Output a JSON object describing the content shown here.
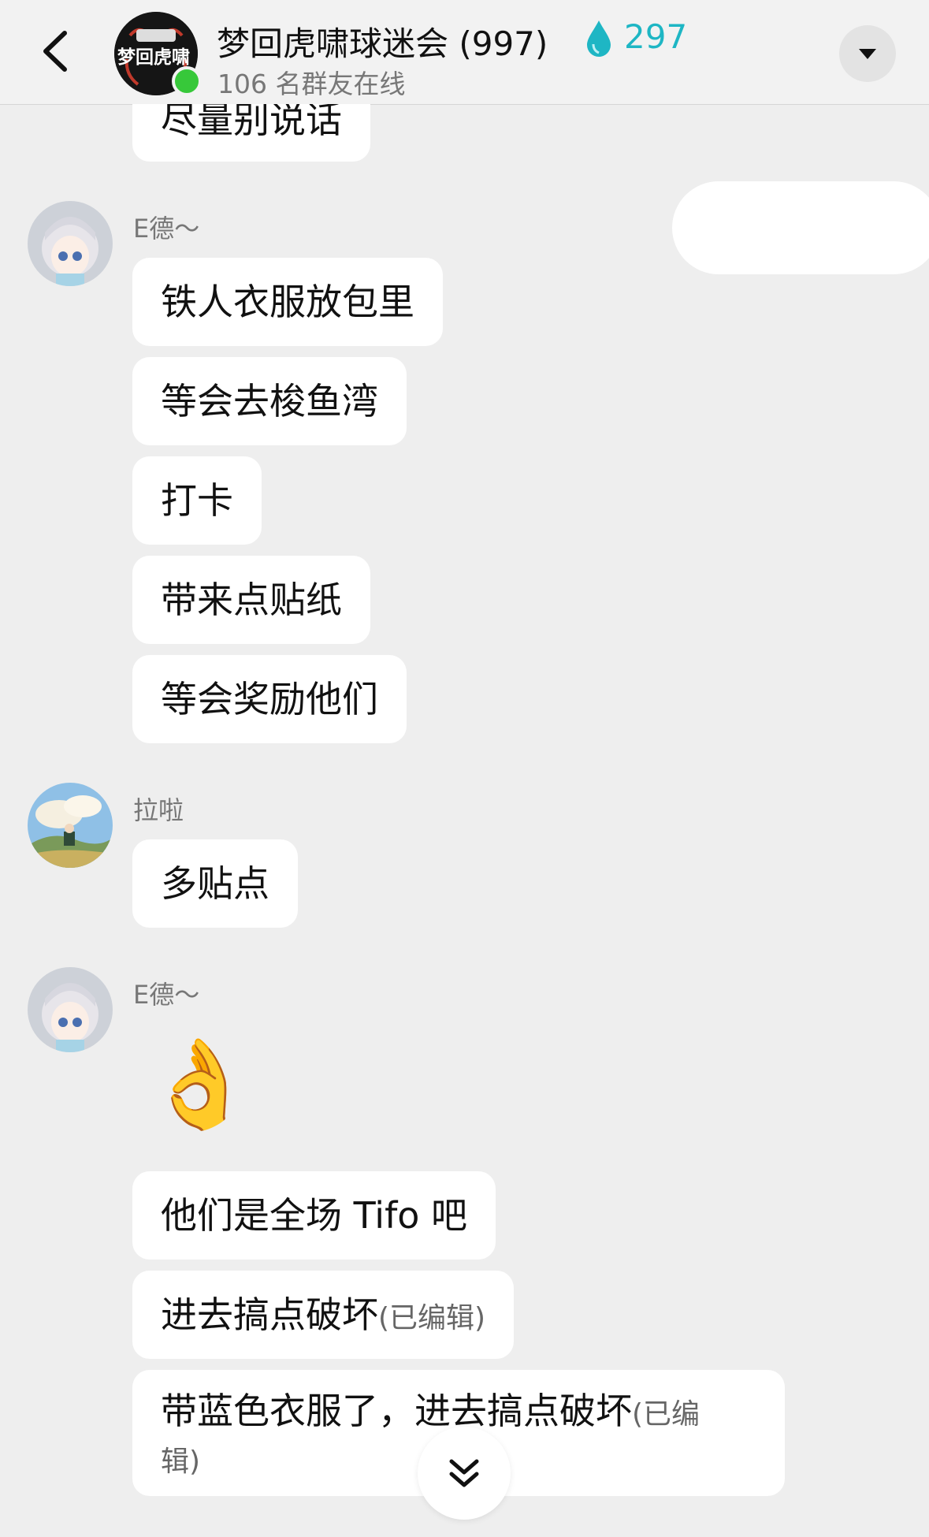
{
  "header": {
    "title": "梦回虎啸球迷会 (997)",
    "heat_count": "297",
    "online_text": "106 名群友在线",
    "avatar_text": "梦回虎啸"
  },
  "messages": [
    {
      "text": "尽量别说话"
    },
    {
      "sender": "E德～",
      "text": "铁人衣服放包里"
    },
    {
      "text": "等会去梭鱼湾"
    },
    {
      "text": "打卡"
    },
    {
      "text": "带来点贴纸"
    },
    {
      "text": "等会奖励他们"
    },
    {
      "sender": "拉啦",
      "text": "多贴点"
    },
    {
      "sender": "E德～",
      "emoji": "👌"
    },
    {
      "text": "他们是全场 Tifo 吧"
    },
    {
      "text": "进去搞点破坏",
      "edited": "(已编辑)"
    },
    {
      "text_line1": "带蓝色衣服了，进去搞点破坏",
      "edited_line1": "(已编",
      "text_line2": "辑)"
    }
  ],
  "colors": {
    "background": "#eeeeee",
    "bubble": "#ffffff",
    "accent_heat": "#1eb6c4",
    "online": "#37c83a"
  },
  "icons": [
    "back-arrow-icon",
    "water-drop-icon",
    "dropdown-icon",
    "double-chevron-down-icon"
  ]
}
